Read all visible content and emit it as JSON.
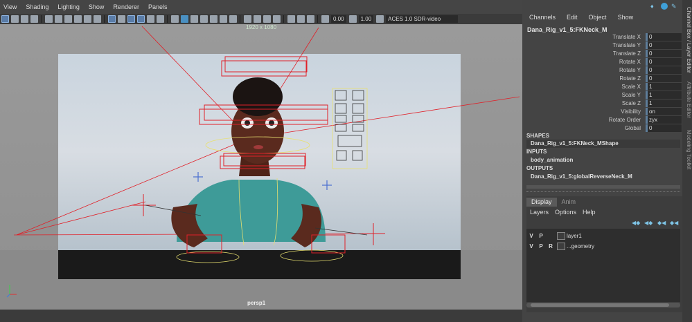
{
  "viewport": {
    "menu": [
      "View",
      "Shading",
      "Lighting",
      "Show",
      "Renderer",
      "Panels"
    ],
    "toolbar": {
      "exposure": "0.00",
      "gamma": "1.00",
      "color_space": "ACES 1.0 SDR-video (sRGB)"
    },
    "resolution": "1920 x 1080",
    "camera": "persp1"
  },
  "channel_box": {
    "menu": [
      "Channels",
      "Edit",
      "Object",
      "Show"
    ],
    "node_name": "Dana_Rig_v1_5:FKNeck_M",
    "attributes": [
      {
        "label": "Translate X",
        "value": "0"
      },
      {
        "label": "Translate Y",
        "value": "0"
      },
      {
        "label": "Translate Z",
        "value": "0"
      },
      {
        "label": "Rotate X",
        "value": "0"
      },
      {
        "label": "Rotate Y",
        "value": "0"
      },
      {
        "label": "Rotate Z",
        "value": "0"
      },
      {
        "label": "Scale X",
        "value": "1"
      },
      {
        "label": "Scale Y",
        "value": "1"
      },
      {
        "label": "Scale Z",
        "value": "1"
      },
      {
        "label": "Visibility",
        "value": "on"
      },
      {
        "label": "Rotate Order",
        "value": "zyx"
      },
      {
        "label": "Global",
        "value": "0"
      }
    ],
    "shapes_header": "SHAPES",
    "shape": "Dana_Rig_v1_5:FKNeck_MShape",
    "inputs_header": "INPUTS",
    "input": "body_animation",
    "outputs_header": "OUTPUTS",
    "output": "Dana_Rig_v1_5:globalReverseNeck_M"
  },
  "layer_editor": {
    "tabs": [
      "Display",
      "Anim"
    ],
    "menu": [
      "Layers",
      "Options",
      "Help"
    ],
    "layers": [
      {
        "v": "V",
        "p": "P",
        "r": "",
        "name": "layer1"
      },
      {
        "v": "V",
        "p": "P",
        "r": "R",
        "name": "...geometry"
      }
    ]
  },
  "side_tabs": [
    "Channel Box / Layer Editor",
    "Attribute Editor",
    "Modeling Toolkit"
  ],
  "colors": {
    "viewport_bg": "#8b8b8b",
    "panel_bg": "#444444",
    "rig_red": "#e0202a",
    "rig_yellow": "#e8e070",
    "shirt": "#3e9b98"
  }
}
